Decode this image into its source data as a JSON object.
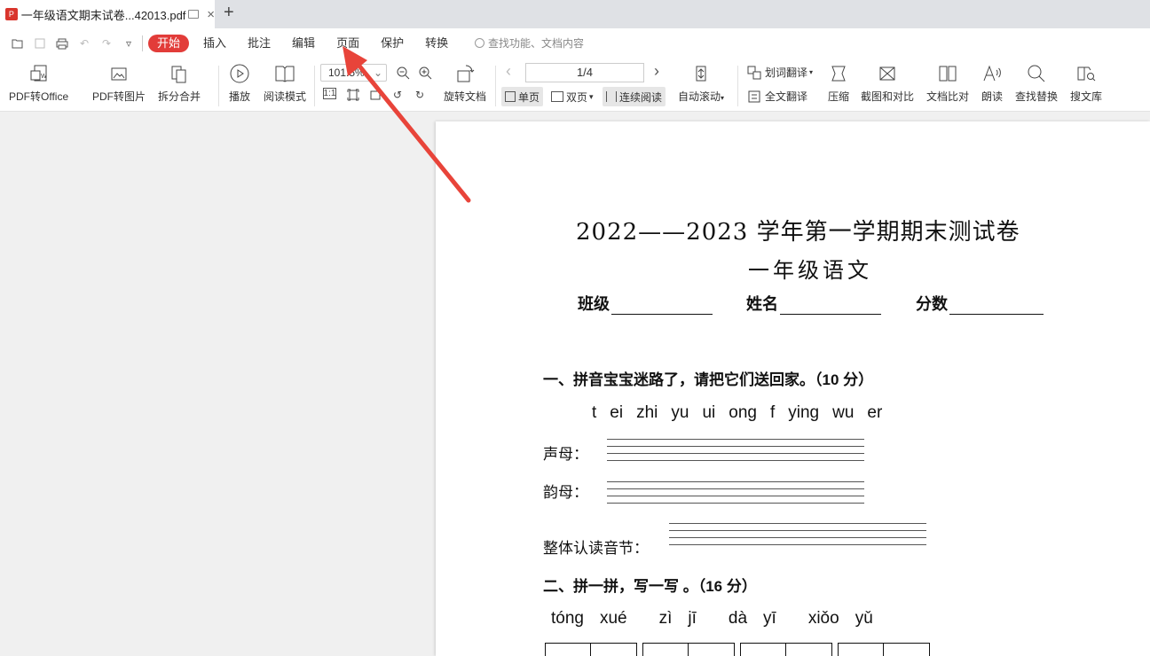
{
  "tab": {
    "title": "一年级语文期末试卷...42013.pdf",
    "new_tab": "+"
  },
  "menu": {
    "items": [
      "开始",
      "插入",
      "批注",
      "编辑",
      "页面",
      "保护",
      "转换"
    ],
    "search_placeholder": "查找功能、文档内容"
  },
  "ribbon": {
    "pdf_to_office": "PDF转Office",
    "pdf_to_image": "PDF转图片",
    "split_merge": "拆分合并",
    "play": "播放",
    "read_mode": "阅读模式",
    "zoom": "101.5%",
    "rotate_doc": "旋转文档",
    "page_indicator": "1/4",
    "single_page": "单页",
    "double_page": "双页",
    "continuous": "连续阅读",
    "auto_scroll": "自动滚动",
    "word_translate": "划词翻译",
    "full_translate": "全文翻译",
    "compress": "压缩",
    "screenshot_compare": "截图和对比",
    "doc_compare": "文档比对",
    "read_aloud": "朗读",
    "find_replace": "查找替换",
    "search_library": "搜文库"
  },
  "document": {
    "title": "2022——2023 学年第一学期期末测试卷",
    "subtitle": "一年级语文",
    "fields": [
      "班级",
      "姓名",
      "分数"
    ],
    "section1": "一、拼音宝宝迷路了，请把它们送回家。（10 分）",
    "pinyin1": [
      "t",
      "ei",
      "zhi",
      "yu",
      "ui",
      "ong",
      "f",
      "ying",
      "wu",
      "er"
    ],
    "shengmu": "声母：",
    "yunmu": "韵母：",
    "zhengti": "整体认读音节：",
    "section2": "二、拼一拼，写一写 。（16 分）",
    "pinyin2": [
      "tóng",
      "xué",
      "zì",
      "jī",
      "dà",
      "yī",
      "xiǒo",
      "yǔ"
    ]
  },
  "colors": {
    "accent": "#e23c39",
    "arrow": "#e8443a"
  }
}
